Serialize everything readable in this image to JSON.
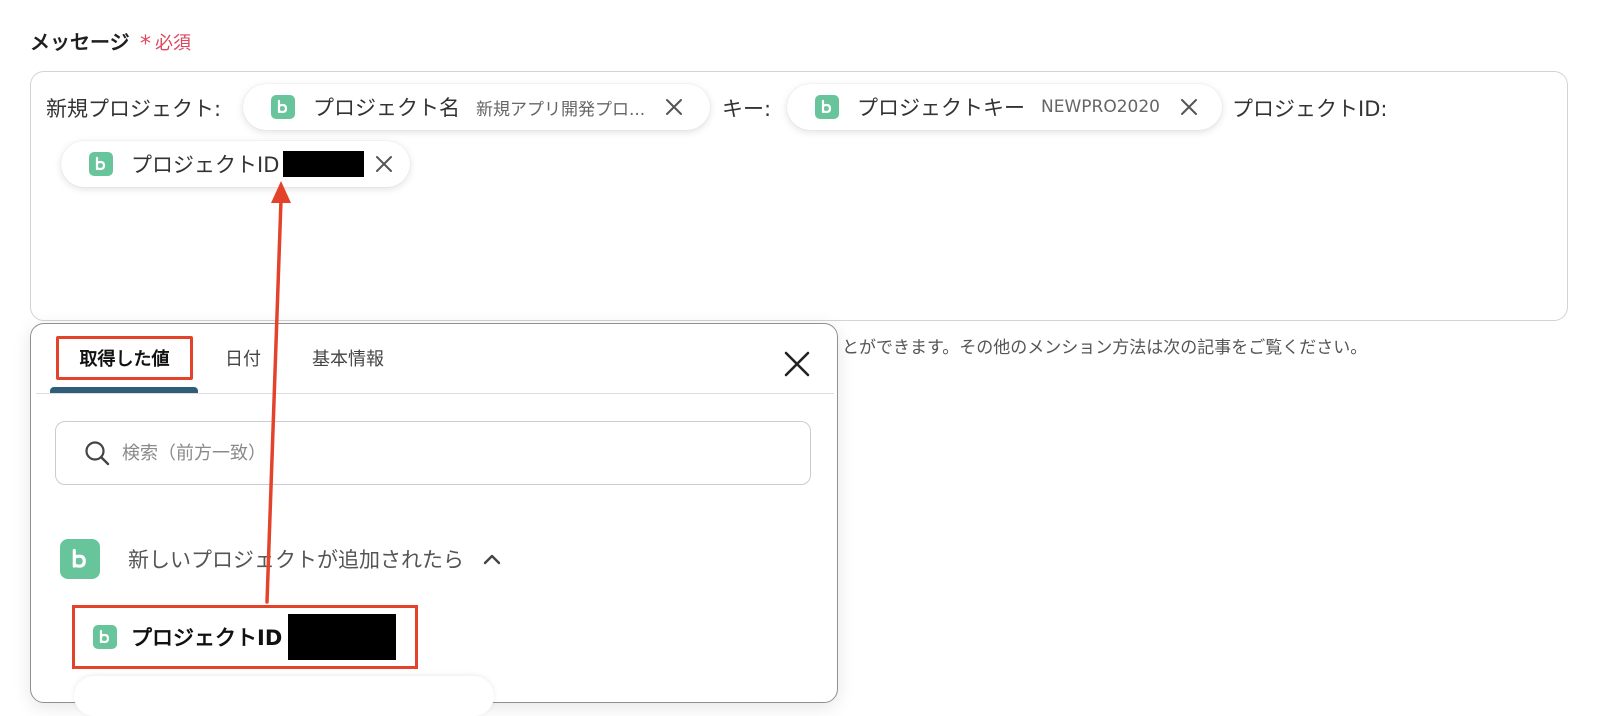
{
  "field": {
    "label": "メッセージ",
    "required_mark": "*",
    "required_text": "必須"
  },
  "message": {
    "segments": {
      "text1": "新規プロジェクト:",
      "pill1_name": "プロジェクト名",
      "pill1_value": "新規アプリ開発プロ...",
      "text2": "キー:",
      "pill2_name": "プロジェクトキー",
      "pill2_value": "NEWPRO2020",
      "text3": "プロジェクトID:",
      "pill3_name": "プロジェクトID"
    }
  },
  "help_text": "とができます。その他のメンション方法は次の記事をご覧ください。",
  "panel": {
    "tabs": [
      {
        "label": "取得した値",
        "active": true
      },
      {
        "label": "日付",
        "active": false
      },
      {
        "label": "基本情報",
        "active": false
      }
    ],
    "search": {
      "placeholder": "検索（前方一致）",
      "value": ""
    },
    "group": {
      "label": "新しいプロジェクトが追加されたら",
      "expanded": true
    },
    "items": [
      {
        "label": "プロジェクトID"
      }
    ]
  },
  "colors": {
    "app_green": "#68c49a",
    "highlight_red": "#e4432b",
    "required_red": "#e0465c",
    "tab_indicator": "#2f5f78"
  },
  "icons": {
    "app": "backlog-icon",
    "remove": "close-icon",
    "search": "search-icon",
    "collapse": "chevron-up-icon"
  }
}
